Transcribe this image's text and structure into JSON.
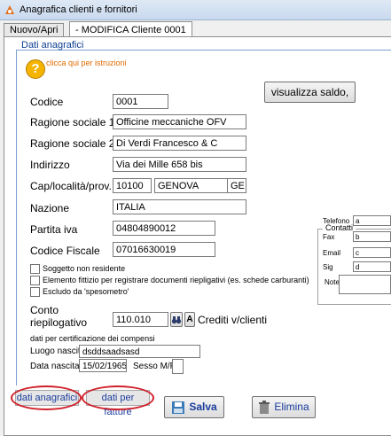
{
  "window": {
    "title": "Anagrafica clienti e fornitori"
  },
  "tabs": [
    {
      "label": "Nuovo/Apri"
    },
    {
      "label": "- MODIFICA Cliente 0001"
    }
  ],
  "frame": {
    "title": "Dati anagrafici"
  },
  "help": {
    "text": "clicca qui per istruzioni"
  },
  "buttons": {
    "saldo": "visualizza saldo,",
    "save": "Salva",
    "delete": "Elimina",
    "binoculars": "A"
  },
  "form": {
    "codice": {
      "label": "Codice",
      "value": "0001"
    },
    "ragione1": {
      "label": "Ragione sociale 1",
      "value": "Officine meccaniche OFV"
    },
    "ragione2": {
      "label": "Ragione sociale 2",
      "value": "Di Verdi Francesco & C"
    },
    "indirizzo": {
      "label": "Indirizzo",
      "value": "Via dei Mille 658 bis"
    },
    "cap": {
      "label": "Cap/località/prov.",
      "cap": "10100",
      "citta": "GENOVA",
      "prov": "GE"
    },
    "nazione": {
      "label": "Nazione",
      "value": "ITALIA"
    },
    "piva": {
      "label": "Partita iva",
      "value": "04804890012"
    },
    "cf": {
      "label": "Codice Fiscale",
      "value": "07016630019"
    }
  },
  "checkboxes": [
    {
      "label": "Soggetto non residente",
      "checked": false
    },
    {
      "label": "Elemento fittizio per registrare documenti riepligativi (es. schede carburanti)",
      "checked": false
    },
    {
      "label": "Escludo da 'spesometro'",
      "checked": false
    }
  ],
  "conto": {
    "label_line1": "Conto",
    "label_line2": "riepilogativo",
    "value": "110.010",
    "description": "Crediti v/clienti"
  },
  "certificazione": {
    "title": "dati per certificazione dei compensi",
    "luogo_label": "Luogo nascita",
    "luogo_value": "dsddsaadsasd",
    "data_label": "Data nascita",
    "data_value": "15/02/1965",
    "sesso_label": "Sesso M/F",
    "sesso_value": ""
  },
  "contatti": {
    "title": "Contatti",
    "telefono": {
      "label": "Telefono",
      "value": "a"
    },
    "fax": {
      "label": "Fax",
      "value": "b"
    },
    "email": {
      "label": "Email",
      "value": "c"
    },
    "sig": {
      "label": "Sig",
      "value": "d"
    },
    "note": {
      "label": "Note",
      "value": ""
    }
  },
  "bottom_tabs": [
    {
      "label": "dati anagrafici"
    },
    {
      "label": "dati per fatture"
    }
  ],
  "colors": {
    "annotation_red": "#d0202a",
    "help_orange": "#e06a00",
    "title_blue": "#0a3d91"
  }
}
